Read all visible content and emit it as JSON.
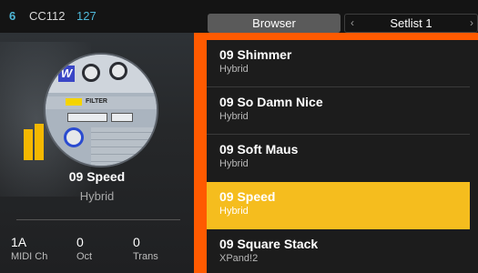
{
  "topbar": {
    "channel_number": "6",
    "cc_label": "CC112",
    "cc_value": "127",
    "browser_button": "Browser",
    "setlist_label": "Setlist 1",
    "prev_icon": "chevron-left-icon",
    "next_icon": "chevron-right-icon"
  },
  "current_preset": {
    "name": "09 Speed",
    "type": "Hybrid"
  },
  "stats": [
    {
      "value": "1A",
      "label": "MIDI Ch"
    },
    {
      "value": "0",
      "label": "Oct"
    },
    {
      "value": "0",
      "label": "Trans"
    }
  ],
  "preset_list": [
    {
      "name": "09 Shimmer",
      "type": "Hybrid",
      "selected": false
    },
    {
      "name": "09 So Damn Nice",
      "type": "Hybrid",
      "selected": false
    },
    {
      "name": "09 Soft Maus",
      "type": "Hybrid",
      "selected": false
    },
    {
      "name": "09 Speed",
      "type": "Hybrid",
      "selected": true
    },
    {
      "name": "09 Square Stack",
      "type": "XPand!2",
      "selected": false
    }
  ],
  "colors": {
    "accent_blue": "#4fb8d8",
    "selection_yellow": "#f5bd1e",
    "frame_orange": "#ff5a00"
  }
}
